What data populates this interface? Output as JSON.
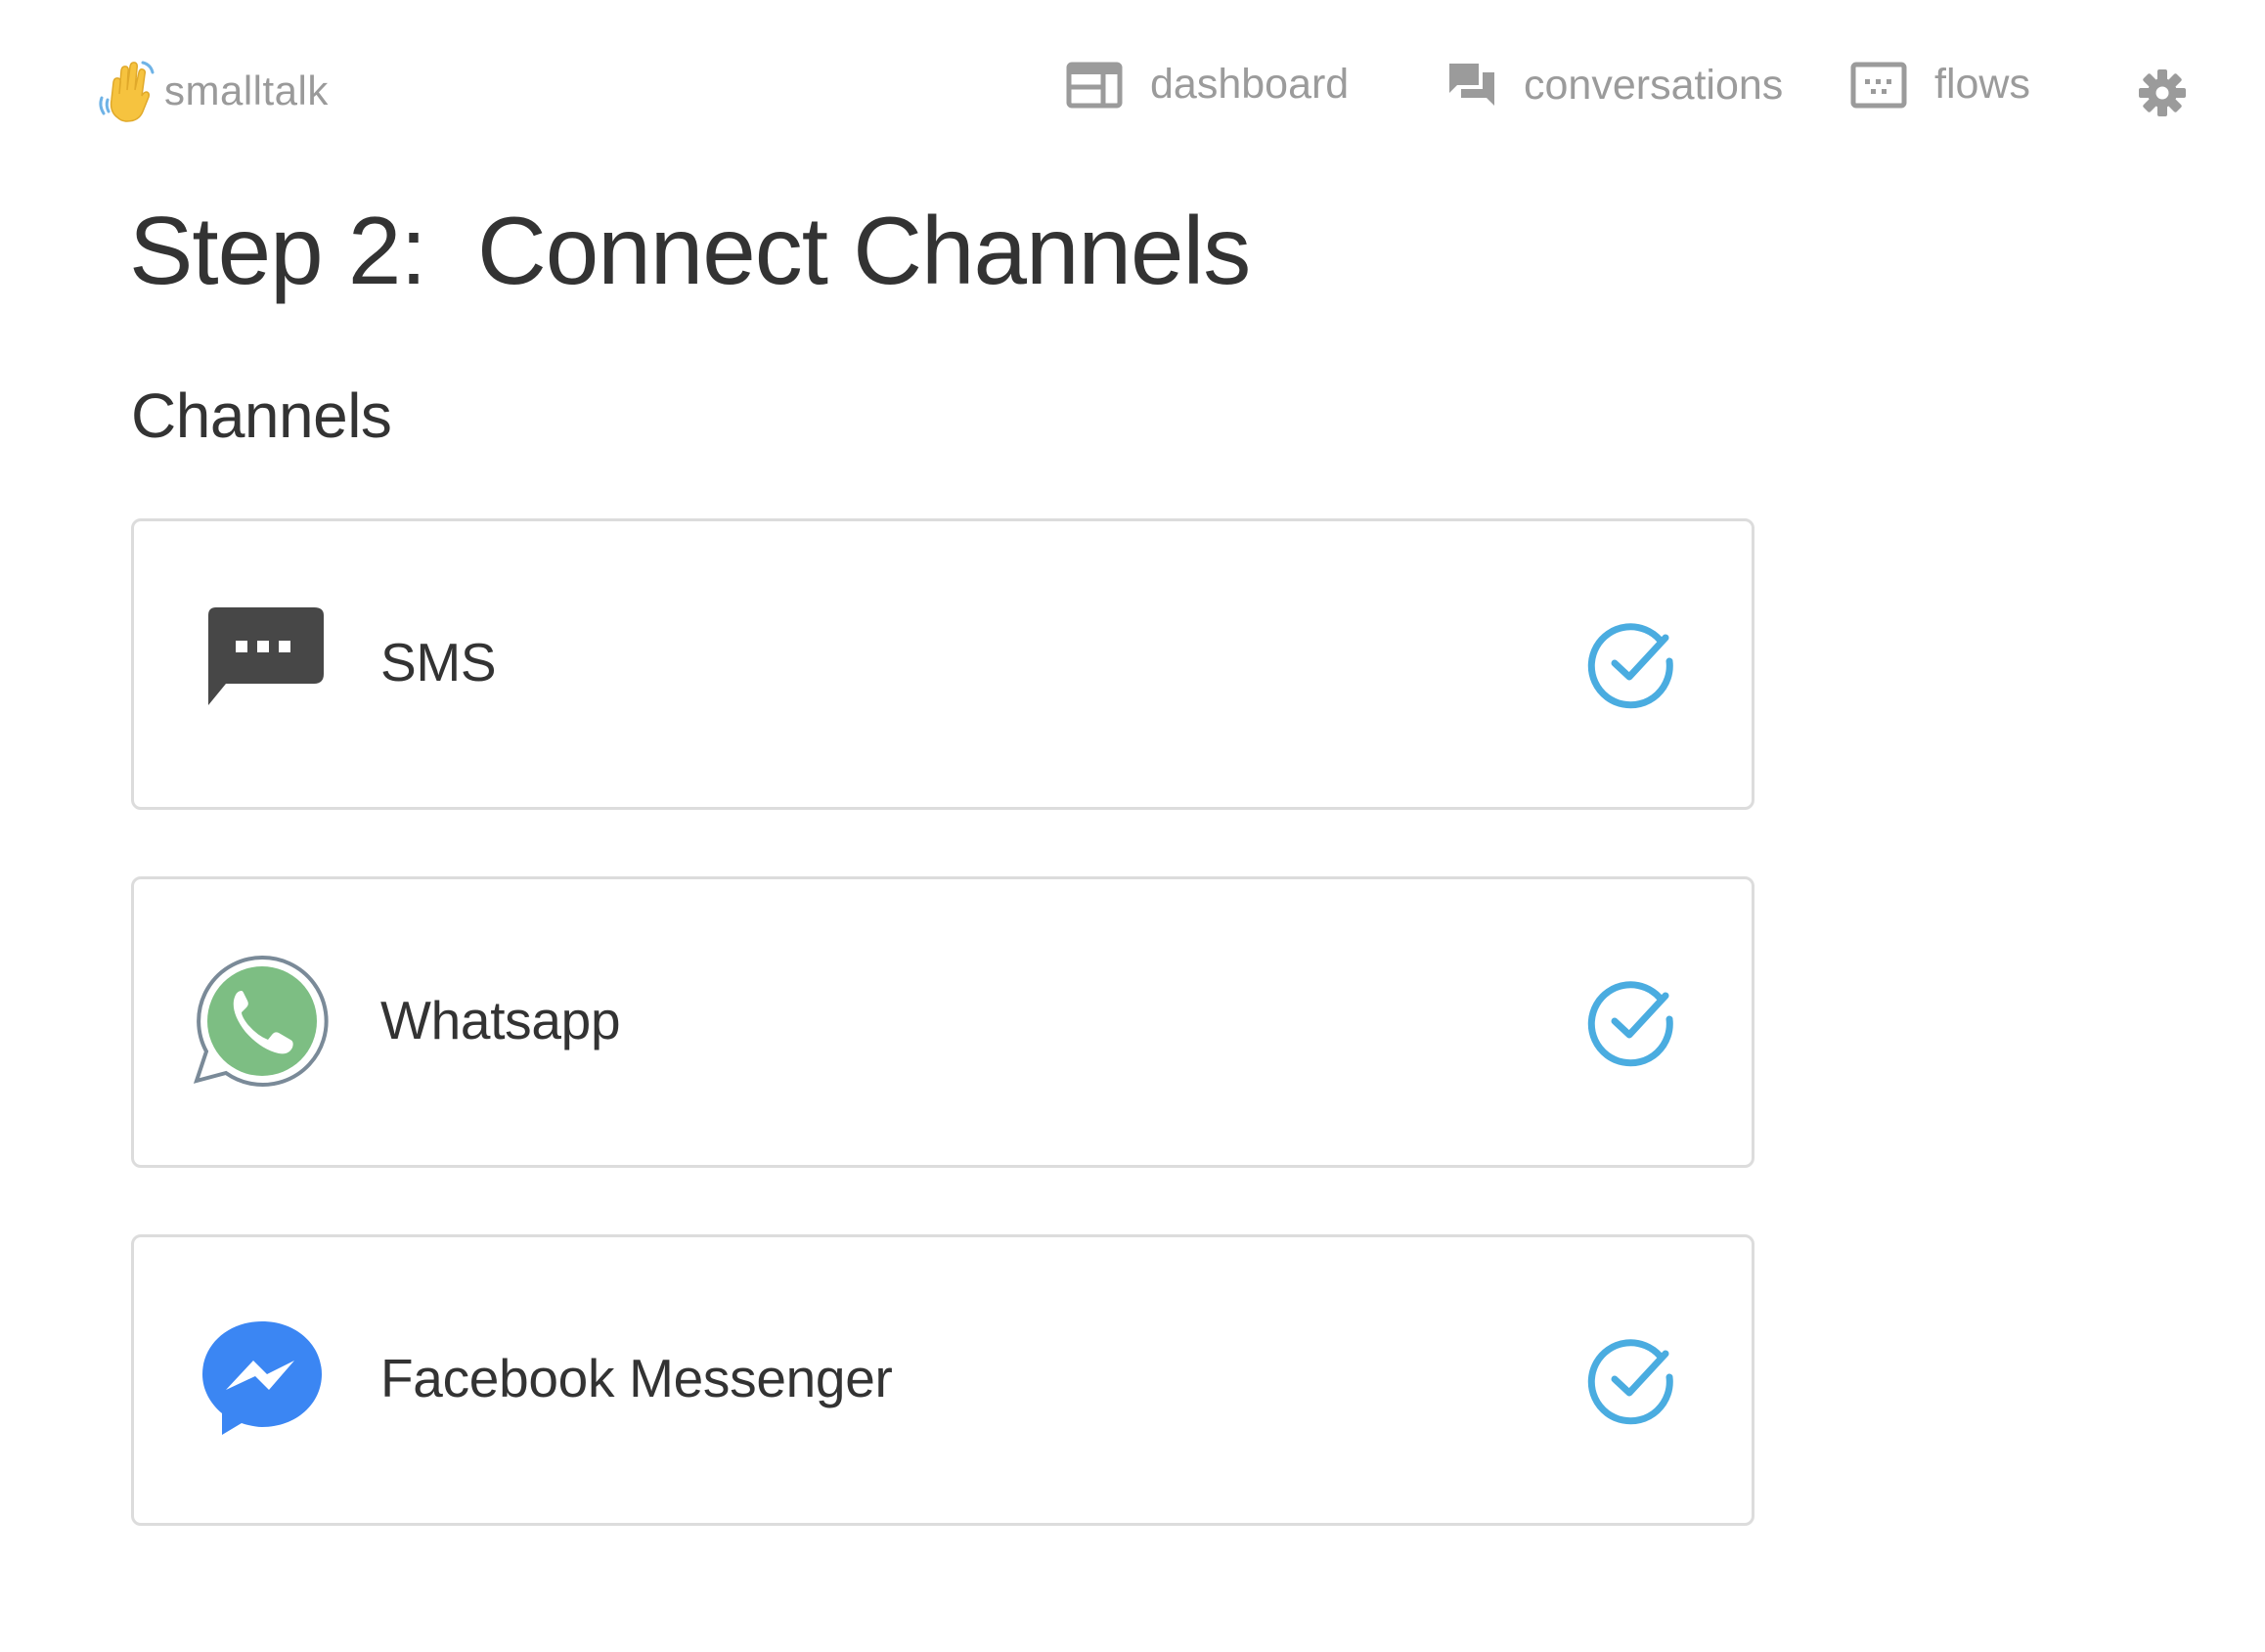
{
  "app": {
    "brand_name": "smalltalk"
  },
  "nav": {
    "items": [
      {
        "label": "dashboard",
        "icon": "dashboard-icon"
      },
      {
        "label": "conversations",
        "icon": "conversations-icon"
      },
      {
        "label": "flows",
        "icon": "flows-icon"
      }
    ],
    "settings_icon": "gear-icon"
  },
  "main": {
    "title": "Step 2:  Connect Channels",
    "section_title": "Channels",
    "channels": [
      {
        "name": "SMS",
        "icon": "sms-icon",
        "connected": true
      },
      {
        "name": "Whatsapp",
        "icon": "whatsapp-icon",
        "connected": true
      },
      {
        "name": "Facebook Messenger",
        "icon": "messenger-icon",
        "connected": true
      }
    ]
  },
  "colors": {
    "text_dark": "#333333",
    "nav_gray": "#9b9b9b",
    "card_border": "#dcdcdc",
    "check_blue": "#4aace0",
    "whatsapp_green": "#7dbe83",
    "messenger_blue": "#3b86f3",
    "sms_dark": "#474747",
    "brand_hand": "#f6c33f"
  }
}
